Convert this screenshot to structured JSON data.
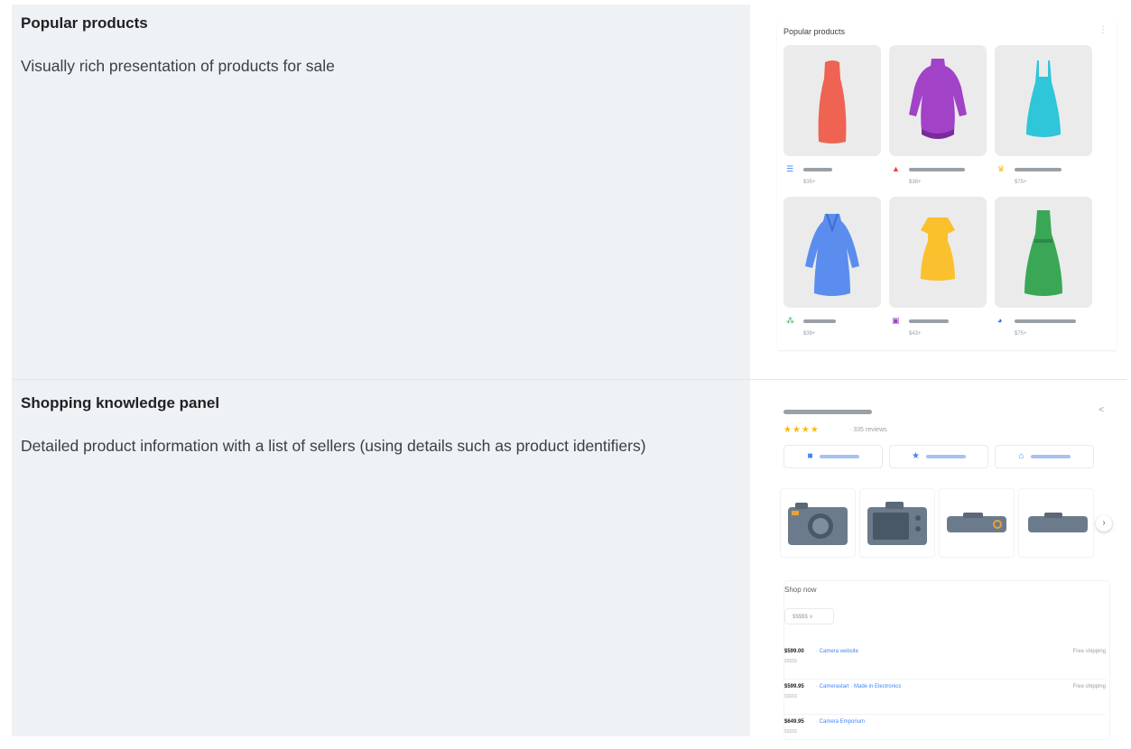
{
  "sections": [
    {
      "title": "Popular products",
      "description": "Visually rich presentation of products for sale"
    },
    {
      "title": "Shopping knowledge panel",
      "description": "Detailed product information with a list of sellers (using details such as product identifiers)"
    }
  ],
  "popular_products": {
    "header": "Popular products",
    "menu_icon": "more-vert-icon",
    "items": [
      {
        "dress_color": "#ee6352",
        "logo_color": "#4285f4",
        "logo_icon": "stacked-bars-logo",
        "price": "$35+"
      },
      {
        "dress_color": "#a142c7",
        "logo_color": "#ea4335",
        "logo_icon": "triangle-logo",
        "price": "$38+"
      },
      {
        "dress_color": "#2ec6d8",
        "logo_color": "#fbbc04",
        "logo_icon": "crown-logo",
        "price": "$75+"
      },
      {
        "dress_color": "#5b8def",
        "logo_color": "#34a853",
        "logo_icon": "squares-logo",
        "price": "$39+"
      },
      {
        "dress_color": "#fbc02d",
        "logo_color": "#a142c7",
        "logo_icon": "square-logo",
        "price": "$43+"
      },
      {
        "dress_color": "#3aa757",
        "logo_color": "#1a73e8",
        "logo_icon": "circle-logo",
        "price": "$75+"
      }
    ]
  },
  "knowledge_panel": {
    "stars": "★★★★",
    "reviews": "· 335 reviews",
    "actions": [
      {
        "icon": "store-icon"
      },
      {
        "icon": "star-icon"
      },
      {
        "icon": "shop-icon"
      }
    ],
    "images": [
      "camera-front-icon",
      "camera-back-icon",
      "camera-top-icon",
      "camera-side-icon"
    ],
    "shop_now": "Shop now",
    "dropdown": "$$$$$ ∨",
    "sellers": [
      {
        "price": "$599.00",
        "name": "· Camera website",
        "shipping": "Free shipping",
        "sub": "$$$$$"
      },
      {
        "price": "$599.95",
        "name": "· Camerastart · Made in Electronics",
        "shipping": "Free shipping",
        "sub": "$$$$$"
      },
      {
        "price": "$649.95",
        "name": "· Camera Emporium",
        "shipping": "",
        "sub": "$$$$$"
      }
    ]
  }
}
